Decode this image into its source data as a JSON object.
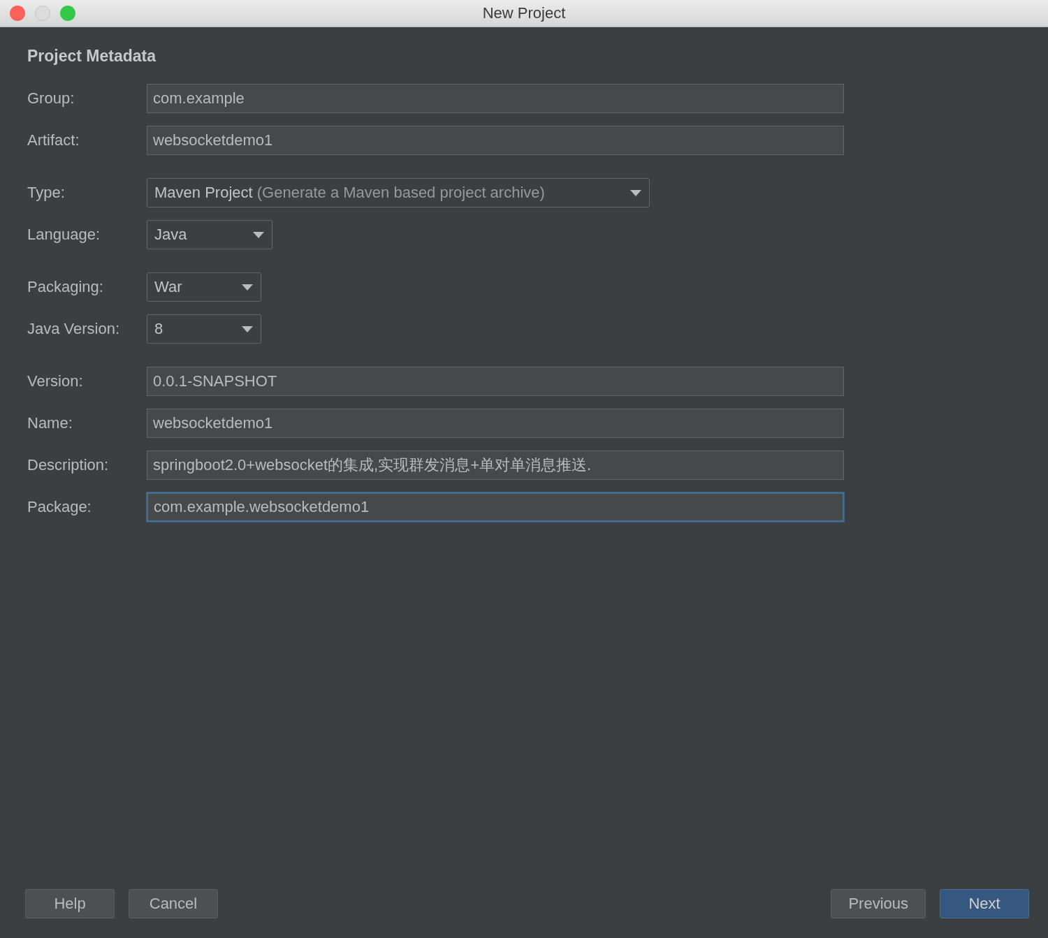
{
  "window": {
    "title": "New Project"
  },
  "heading": "Project Metadata",
  "sections": [
    {
      "fields": [
        {
          "kind": "text",
          "label": "Group:",
          "value": "com.example",
          "focused": false
        },
        {
          "kind": "text",
          "label": "Artifact:",
          "value": "websocketdemo1",
          "focused": false
        }
      ]
    },
    {
      "fields": [
        {
          "kind": "dropdown",
          "label": "Type:",
          "value": "Maven Project",
          "hint": "(Generate a Maven based project archive)",
          "focused": false
        },
        {
          "kind": "dropdown",
          "label": "Language:",
          "value": "Java",
          "focused": false
        }
      ]
    },
    {
      "fields": [
        {
          "kind": "dropdown",
          "label": "Packaging:",
          "value": "War",
          "focused": false
        },
        {
          "kind": "dropdown",
          "label": "Java Version:",
          "value": "8",
          "focused": false
        }
      ]
    },
    {
      "fields": [
        {
          "kind": "text",
          "label": "Version:",
          "value": "0.0.1-SNAPSHOT",
          "focused": false
        },
        {
          "kind": "text",
          "label": "Name:",
          "value": "websocketdemo1",
          "focused": false
        },
        {
          "kind": "text",
          "label": "Description:",
          "value": "springboot2.0+websocket的集成,实现群发消息+单对单消息推送.",
          "focused": false
        },
        {
          "kind": "text",
          "label": "Package:",
          "value": "com.example.websocketdemo1",
          "focused": true
        }
      ]
    }
  ],
  "buttons_left": [
    {
      "label": "Help",
      "default": false
    },
    {
      "label": "Cancel",
      "default": false
    }
  ],
  "buttons_right": [
    {
      "label": "Previous",
      "default": false
    },
    {
      "label": "Next",
      "default": true
    }
  ]
}
